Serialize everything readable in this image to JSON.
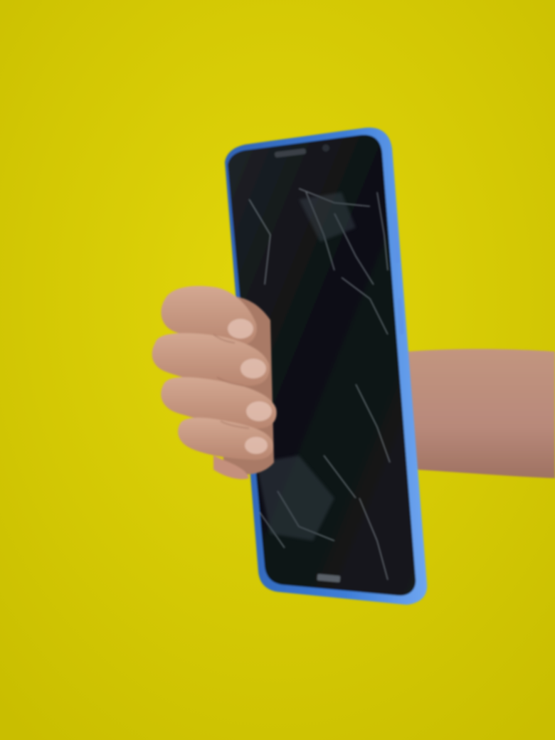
{
  "photo": {
    "subject": "hand-holding-cracked-phone",
    "colors": {
      "background": "#D6CB00",
      "background_light": "#E2D60A",
      "phone_frame": "#3E7ED8",
      "phone_frame_highlight": "#6FA6F0",
      "screen": "#0E1013",
      "screen_edge": "#1E2328",
      "crack": "#9AA4AC",
      "skin": "#C99C86",
      "skin_shadow": "#A87A66",
      "nail": "#E3C2B4"
    }
  }
}
